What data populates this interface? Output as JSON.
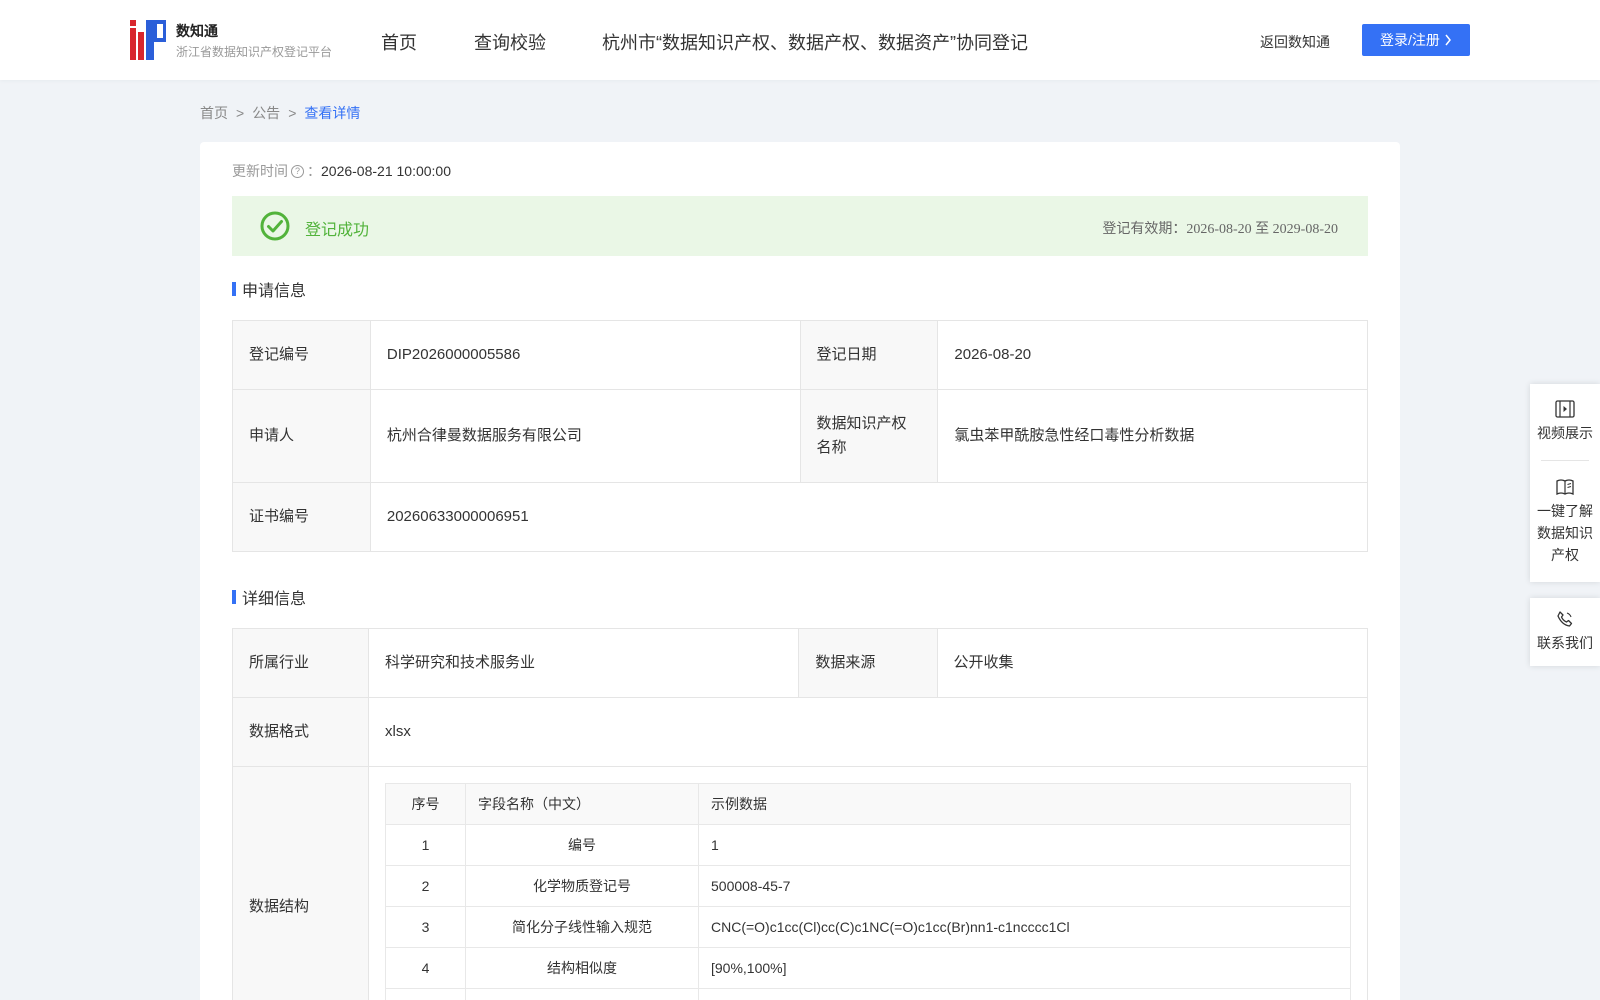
{
  "header": {
    "logo_title": "数知通",
    "logo_subtitle": "浙江省数据知识产权登记平台",
    "nav": [
      "首页",
      "查询校验",
      "杭州市“数据知识产权、数据产权、数据资产”协同登记"
    ],
    "back_link": "返回数知通",
    "login_label": "登录/注册",
    "accent_color": "#3471f5"
  },
  "breadcrumb": [
    "首页",
    "公告",
    "查看详情"
  ],
  "update": {
    "label": "更新时间",
    "colon": "：",
    "value": "2026-08-21 10:00:00"
  },
  "status": {
    "text": "登记成功",
    "validity": "登记有效期：2026-08-20 至 2029-08-20",
    "color": "#52b33b"
  },
  "apply_section": {
    "title": "申请信息",
    "reg_no_label": "登记编号",
    "reg_no": "DIP2026000005586",
    "reg_date_label": "登记日期",
    "reg_date": "2026-08-20",
    "applicant_label": "申请人",
    "applicant": "杭州合律曼数据服务有限公司",
    "ip_name_label": "数据知识产权名称",
    "ip_name": "氯虫苯甲酰胺急性经口毒性分析数据",
    "cert_no_label": "证书编号",
    "cert_no": "20260633000006951"
  },
  "detail_section": {
    "title": "详细信息",
    "industry_label": "所属行业",
    "industry": "科学研究和技术服务业",
    "source_label": "数据来源",
    "source": "公开收集",
    "format_label": "数据格式",
    "format": "xlsx",
    "structure_label": "数据结构",
    "structure_headers": [
      "序号",
      "字段名称（中文）",
      "示例数据"
    ],
    "structure_rows": [
      [
        "1",
        "编号",
        "1"
      ],
      [
        "2",
        "化学物质登记号",
        "500008-45-7"
      ],
      [
        "3",
        "简化分子线性输入规范",
        "CNC(=O)c1cc(Cl)cc(C)c1NC(=O)c1cc(Br)nn1-c1ncccc1Cl"
      ],
      [
        "4",
        "结构相似度",
        "[90%,100%]"
      ],
      [
        "",
        "",
        ""
      ]
    ]
  },
  "sidebar": {
    "video": "视频展示",
    "learn": "一键了解数据知识产权",
    "contact": "联系我们"
  }
}
